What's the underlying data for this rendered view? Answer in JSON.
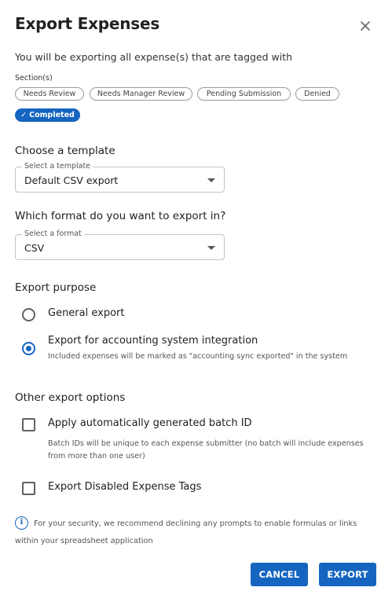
{
  "dialog": {
    "title": "Export Expenses",
    "close_icon": "close-icon",
    "subtitle": "You will be exporting all expense(s) that are tagged with"
  },
  "sections": {
    "label": "Section(s)",
    "chips": [
      {
        "label": "Needs Review",
        "selected": false
      },
      {
        "label": "Needs Manager Review",
        "selected": false
      },
      {
        "label": "Pending Submission",
        "selected": false
      },
      {
        "label": "Denied",
        "selected": false
      },
      {
        "label": "Completed",
        "selected": true
      }
    ],
    "check_icon": "check-icon"
  },
  "template": {
    "heading": "Choose a template",
    "select_label": "Select a template",
    "value": "Default CSV export"
  },
  "format": {
    "heading": "Which format do you want to export in?",
    "select_label": "Select a format",
    "value": "CSV"
  },
  "purpose": {
    "heading": "Export purpose",
    "options": [
      {
        "label": "General export",
        "checked": false,
        "help": ""
      },
      {
        "label": "Export for accounting system integration",
        "checked": true,
        "help": "Included expenses will be marked as \"accounting sync exported\" in the system"
      }
    ]
  },
  "other_options": {
    "heading": "Other export options",
    "options": [
      {
        "label": "Apply automatically generated batch ID",
        "checked": false,
        "help_line1": "Batch IDs will be unique to each expense submitter (no batch will include expenses",
        "help_line2": "from more than one user)"
      },
      {
        "label": "Export Disabled Expense Tags",
        "checked": false
      }
    ]
  },
  "note": {
    "icon": "info-icon",
    "text": "For your security, we recommend declining any prompts to enable formulas or links within your spreadsheet application"
  },
  "actions": {
    "cancel_label": "CANCEL",
    "export_label": "EXPORT"
  },
  "colors": {
    "primary": "#1565c0",
    "text": "#212121",
    "muted": "#555555"
  }
}
